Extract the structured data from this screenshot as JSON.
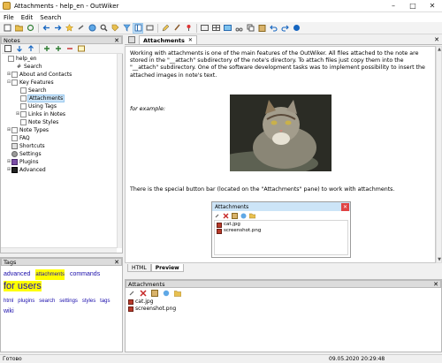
{
  "window": {
    "title": "Attachments - help_en - OutWiker",
    "minimize": "–",
    "maximize": "□",
    "close": "✕"
  },
  "menu": [
    "File",
    "Edit",
    "Search"
  ],
  "notes_pane": {
    "title": "Notes",
    "tree": [
      {
        "label": "help_en",
        "icon": "page",
        "level": 0,
        "expander": ""
      },
      {
        "label": "Search",
        "icon": "hash",
        "level": 1,
        "expander": "",
        "prefix": "#"
      },
      {
        "label": "About and Contacts",
        "icon": "page",
        "level": 1,
        "expander": "⊞"
      },
      {
        "label": "Key Features",
        "icon": "page",
        "level": 1,
        "expander": "⊟"
      },
      {
        "label": "Search",
        "icon": "page",
        "level": 2,
        "expander": ""
      },
      {
        "label": "Attachments",
        "icon": "page",
        "level": 2,
        "expander": "",
        "selected": true
      },
      {
        "label": "Using Tags",
        "icon": "page",
        "level": 2,
        "expander": ""
      },
      {
        "label": "Links in Notes",
        "icon": "page",
        "level": 2,
        "expander": "⊞"
      },
      {
        "label": "Note Styles",
        "icon": "page",
        "level": 2,
        "expander": ""
      },
      {
        "label": "Note Types",
        "icon": "page",
        "level": 1,
        "expander": "⊞"
      },
      {
        "label": "FAQ",
        "icon": "page",
        "level": 1,
        "expander": ""
      },
      {
        "label": "Shortcuts",
        "icon": "shortcut",
        "level": 1,
        "expander": ""
      },
      {
        "label": "Settings",
        "icon": "cog",
        "level": 1,
        "expander": ""
      },
      {
        "label": "Plugins",
        "icon": "plug",
        "level": 1,
        "expander": "⊞"
      },
      {
        "label": "Advanced",
        "icon": "adv",
        "level": 1,
        "expander": "⊞"
      }
    ]
  },
  "tags_pane": {
    "title": "Tags",
    "row1": [
      {
        "label": "advanced",
        "size": 7,
        "hl": false
      },
      {
        "label": "attachments",
        "size": 6,
        "hl": true
      },
      {
        "label": "commands",
        "size": 7,
        "hl": false
      },
      {
        "label": "for users",
        "size": 11,
        "hl": true
      }
    ],
    "row2": [
      {
        "label": "html",
        "size": 6,
        "hl": false
      },
      {
        "label": "plugins",
        "size": 6,
        "hl": false
      },
      {
        "label": "search",
        "size": 6,
        "hl": false
      },
      {
        "label": "settings",
        "size": 6,
        "hl": false
      },
      {
        "label": "styles",
        "size": 6,
        "hl": false
      },
      {
        "label": "tags",
        "size": 6,
        "hl": false
      },
      {
        "label": "wiki",
        "size": 7,
        "hl": false
      }
    ]
  },
  "editor": {
    "tab_label": "Attachments",
    "tab_close": "✕",
    "paragraph1": "Working with attachments is one of the main features of the OutWiker. All files attached to the note are stored in the \"__attach\" subdirectory of the note's directory. To attach files just copy them into the \"__attach\" subdirectory. One of the software development tasks was to implement possibility to insert the attached images in note's text.",
    "paragraph2": "for example:",
    "paragraph3": "There is the special button bar (located on the \"Attachments\" pane) to work with attachments.",
    "mini_pane": {
      "title": "Attachments",
      "files": [
        "cat.jpg",
        "screenshot.png"
      ]
    },
    "modes": [
      "HTML",
      "Preview"
    ],
    "active_mode": "Preview"
  },
  "attachments_pane": {
    "title": "Attachments",
    "files": [
      "cat.jpg",
      "screenshot.png"
    ]
  },
  "statusbar": {
    "left": "Готово",
    "datetime": "09.05.2020 20:29:48"
  }
}
